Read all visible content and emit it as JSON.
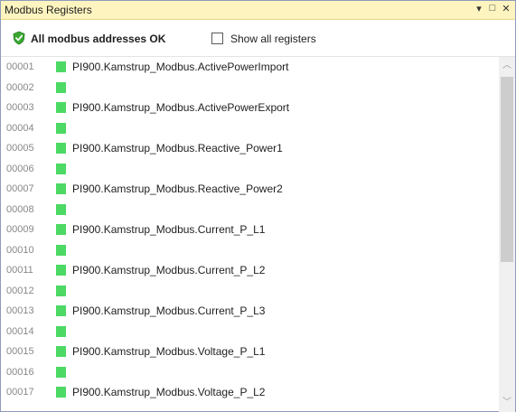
{
  "window": {
    "title": "Modbus Registers",
    "controls": {
      "dropdown": "▾",
      "maximize": "□",
      "close": "✕"
    }
  },
  "toolbar": {
    "status_icon": "check-shield-icon",
    "status_text": "All modbus addresses OK",
    "show_all_label": "Show all registers",
    "show_all_checked": false
  },
  "colors": {
    "titlebar_bg": "#fdf4bf",
    "marker_green": "#4cd964",
    "status_icon_green": "#3aa830"
  },
  "registers": [
    {
      "addr": "00001",
      "name": "PI900.Kamstrup_Modbus.ActivePowerImport"
    },
    {
      "addr": "00002",
      "name": ""
    },
    {
      "addr": "00003",
      "name": "PI900.Kamstrup_Modbus.ActivePowerExport"
    },
    {
      "addr": "00004",
      "name": ""
    },
    {
      "addr": "00005",
      "name": "PI900.Kamstrup_Modbus.Reactive_Power1"
    },
    {
      "addr": "00006",
      "name": ""
    },
    {
      "addr": "00007",
      "name": "PI900.Kamstrup_Modbus.Reactive_Power2"
    },
    {
      "addr": "00008",
      "name": ""
    },
    {
      "addr": "00009",
      "name": "PI900.Kamstrup_Modbus.Current_P_L1"
    },
    {
      "addr": "00010",
      "name": ""
    },
    {
      "addr": "00011",
      "name": "PI900.Kamstrup_Modbus.Current_P_L2"
    },
    {
      "addr": "00012",
      "name": ""
    },
    {
      "addr": "00013",
      "name": "PI900.Kamstrup_Modbus.Current_P_L3"
    },
    {
      "addr": "00014",
      "name": ""
    },
    {
      "addr": "00015",
      "name": "PI900.Kamstrup_Modbus.Voltage_P_L1"
    },
    {
      "addr": "00016",
      "name": ""
    },
    {
      "addr": "00017",
      "name": "PI900.Kamstrup_Modbus.Voltage_P_L2"
    }
  ]
}
